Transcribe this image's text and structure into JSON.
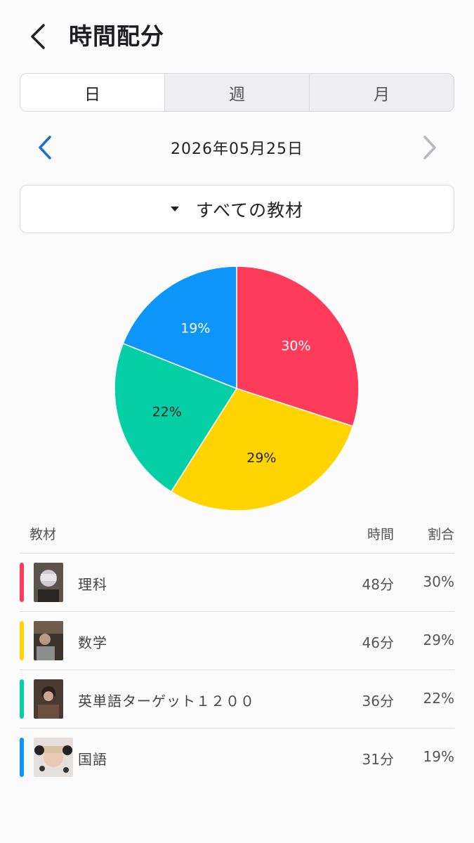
{
  "header": {
    "title": "時間配分",
    "back_icon": "chevron-left-icon"
  },
  "period_tabs": [
    {
      "label": "日",
      "active": true
    },
    {
      "label": "週",
      "active": false
    },
    {
      "label": "月",
      "active": false
    }
  ],
  "date_nav": {
    "date": "2026年05月25日",
    "prev_icon": "chevron-left-icon",
    "next_icon": "chevron-right-icon",
    "prev_color": "#1a6fd1",
    "next_color": "#b8b8c0"
  },
  "filter": {
    "label": "すべての教材",
    "icon": "caret-down-icon"
  },
  "chart_data": {
    "type": "pie",
    "categories": [
      "理科",
      "数学",
      "英単語ターゲット１２００",
      "国語"
    ],
    "values": [
      30,
      29,
      22,
      19
    ],
    "labels": [
      "30%",
      "29%",
      "22%",
      "19%"
    ],
    "colors": [
      "#ff3b5c",
      "#ffd400",
      "#05cfa4",
      "#0e95fa"
    ],
    "label_colors": [
      "#ffffff",
      "#222222",
      "#222222",
      "#ffffff"
    ]
  },
  "table": {
    "headers": {
      "name": "教材",
      "time": "時間",
      "ratio": "割合"
    },
    "rows": [
      {
        "name": "理科",
        "time": "48分",
        "ratio": "30%",
        "color": "#ff3b5c"
      },
      {
        "name": "数学",
        "time": "46分",
        "ratio": "29%",
        "color": "#ffd400"
      },
      {
        "name": "英単語ターゲット１２００",
        "time": "36分",
        "ratio": "22%",
        "color": "#05cfa4"
      },
      {
        "name": "国語",
        "time": "31分",
        "ratio": "19%",
        "color": "#0e95fa"
      }
    ]
  }
}
